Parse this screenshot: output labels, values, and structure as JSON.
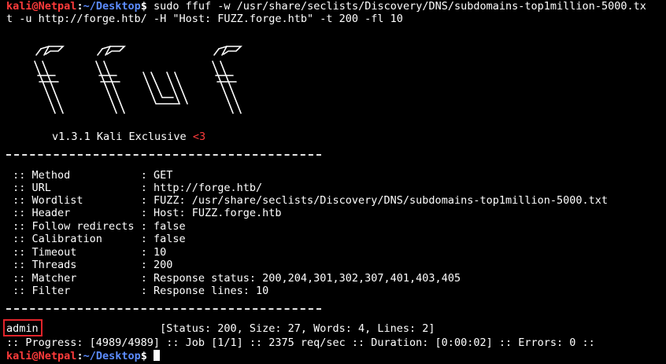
{
  "prompt": {
    "user": "kali",
    "at": "@",
    "host": "Netpal",
    "sep": ":",
    "path": "~/Desktop",
    "dollar": "$"
  },
  "command": {
    "line1": " sudo ffuf -w /usr/share/seclists/Discovery/DNS/subdomains-top1million-5000.tx",
    "line2": "t -u http://forge.htb/ -H \"Host: FUZZ.forge.htb\" -t 200 -fl 10"
  },
  "banner": {
    "version_text": "v1.3.1 Kali Exclusive ",
    "heart": "<3"
  },
  "config": [
    {
      "label": " :: Method           ",
      "value": ": GET"
    },
    {
      "label": " :: URL              ",
      "value": ": http://forge.htb/"
    },
    {
      "label": " :: Wordlist         ",
      "value": ": FUZZ: /usr/share/seclists/Discovery/DNS/subdomains-top1million-5000.txt"
    },
    {
      "label": " :: Header           ",
      "value": ": Host: FUZZ.forge.htb"
    },
    {
      "label": " :: Follow redirects ",
      "value": ": false"
    },
    {
      "label": " :: Calibration      ",
      "value": ": false"
    },
    {
      "label": " :: Timeout          ",
      "value": ": 10"
    },
    {
      "label": " :: Threads          ",
      "value": ": 200"
    },
    {
      "label": " :: Matcher          ",
      "value": ": Response status: 200,204,301,302,307,401,403,405"
    },
    {
      "label": " :: Filter           ",
      "value": ": Response lines: 10"
    }
  ],
  "result": {
    "word": "admin",
    "details": "                   [Status: 200, Size: 27, Words: 4, Lines: 2]"
  },
  "progress": ":: Progress: [4989/4989] :: Job [1/1] :: 2375 req/sec :: Duration: [0:00:02] :: Errors: 0 ::",
  "colors": {
    "prompt_red": "#ff3b3b",
    "prompt_blue": "#5c8cff",
    "highlight_box": "#e0242a"
  }
}
